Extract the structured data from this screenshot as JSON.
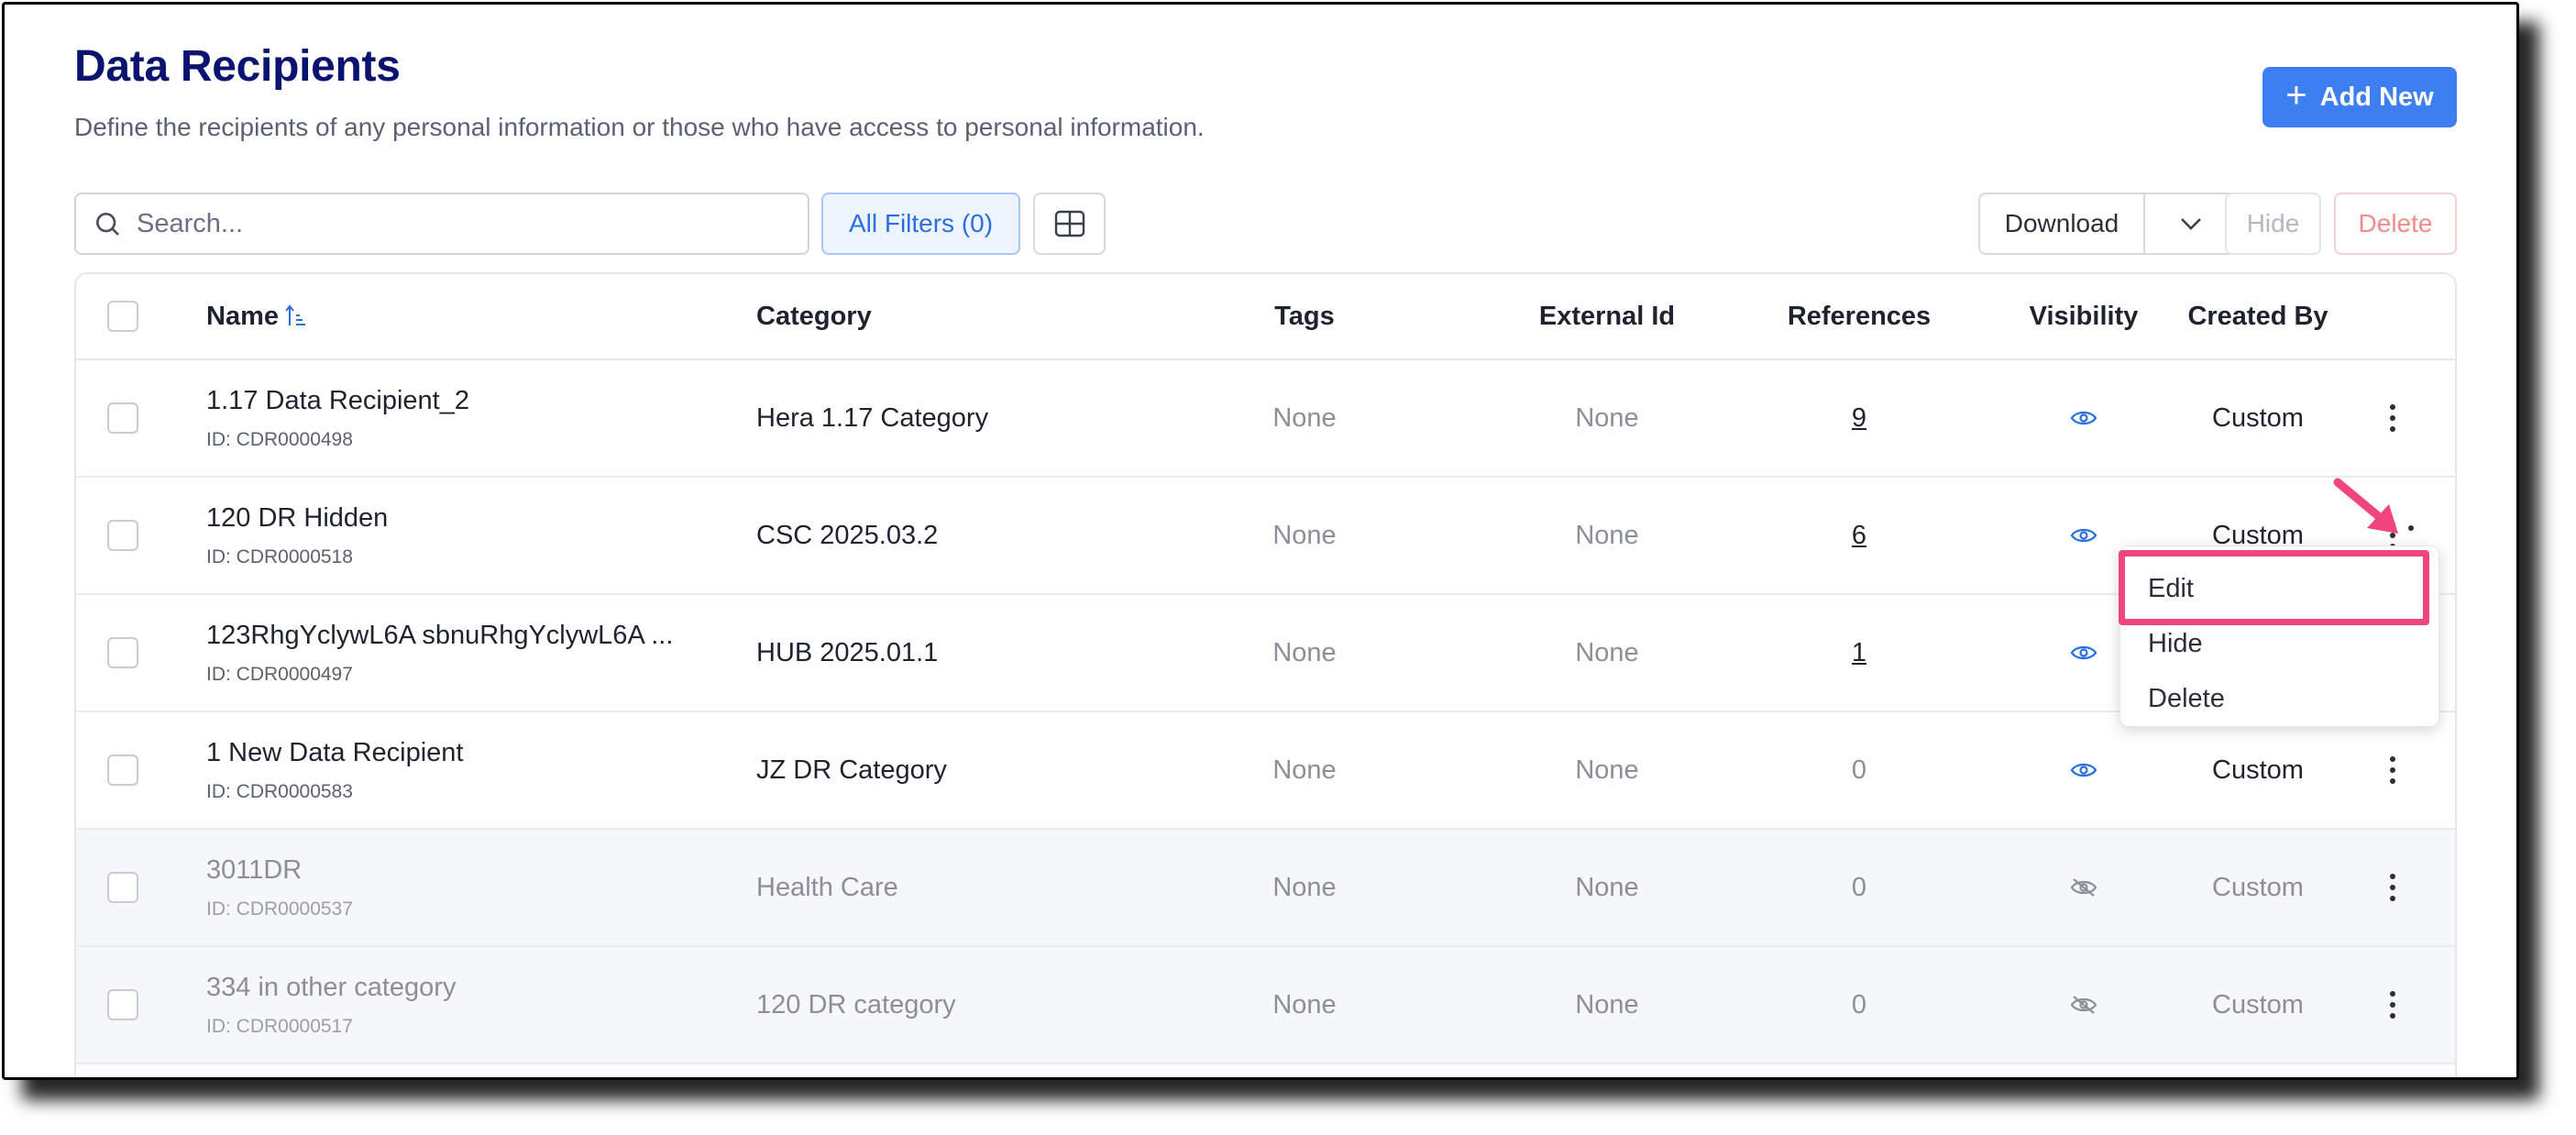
{
  "header": {
    "title": "Data Recipients",
    "subtitle": "Define the recipients of any personal information or those who have access to personal information.",
    "add_button": "Add New"
  },
  "toolbar": {
    "search_placeholder": "Search...",
    "filters_label": "All Filters (0)",
    "download_label": "Download",
    "hide_label": "Hide",
    "delete_label": "Delete"
  },
  "table": {
    "columns": [
      "Name",
      "Category",
      "Tags",
      "External Id",
      "References",
      "Visibility",
      "Created By"
    ],
    "rows": [
      {
        "name": "1.17 Data Recipient_2",
        "id": "ID: CDR0000498",
        "category": "Hera 1.17 Category",
        "tags": "None",
        "external_id": "None",
        "references": "9",
        "visible": true,
        "created_by": "Custom"
      },
      {
        "name": "120 DR Hidden",
        "id": "ID: CDR0000518",
        "category": "CSC 2025.03.2",
        "tags": "None",
        "external_id": "None",
        "references": "6",
        "visible": true,
        "created_by": "Custom"
      },
      {
        "name": "123RhgYclywL6A sbnuRhgYclywL6A ...",
        "id": "ID: CDR0000497",
        "category": "HUB 2025.01.1",
        "tags": "None",
        "external_id": "None",
        "references": "1",
        "visible": true,
        "created_by": ""
      },
      {
        "name": "1 New Data Recipient",
        "id": "ID: CDR0000583",
        "category": "JZ DR Category",
        "tags": "None",
        "external_id": "None",
        "references": "0",
        "visible": true,
        "created_by": "Custom"
      },
      {
        "name": "3011DR",
        "id": "ID: CDR0000537",
        "category": "Health Care",
        "tags": "None",
        "external_id": "None",
        "references": "0",
        "visible": false,
        "created_by": "Custom"
      },
      {
        "name": "334 in other category",
        "id": "ID: CDR0000517",
        "category": "120 DR category",
        "tags": "None",
        "external_id": "None",
        "references": "0",
        "visible": false,
        "created_by": "Custom"
      }
    ]
  },
  "context_menu": {
    "items": [
      "Edit",
      "Hide",
      "Delete"
    ]
  },
  "colors": {
    "title": "#0a1470",
    "primary": "#3d7ff0",
    "highlight": "#f0457f",
    "eye_icon": "#2a6fe0"
  }
}
